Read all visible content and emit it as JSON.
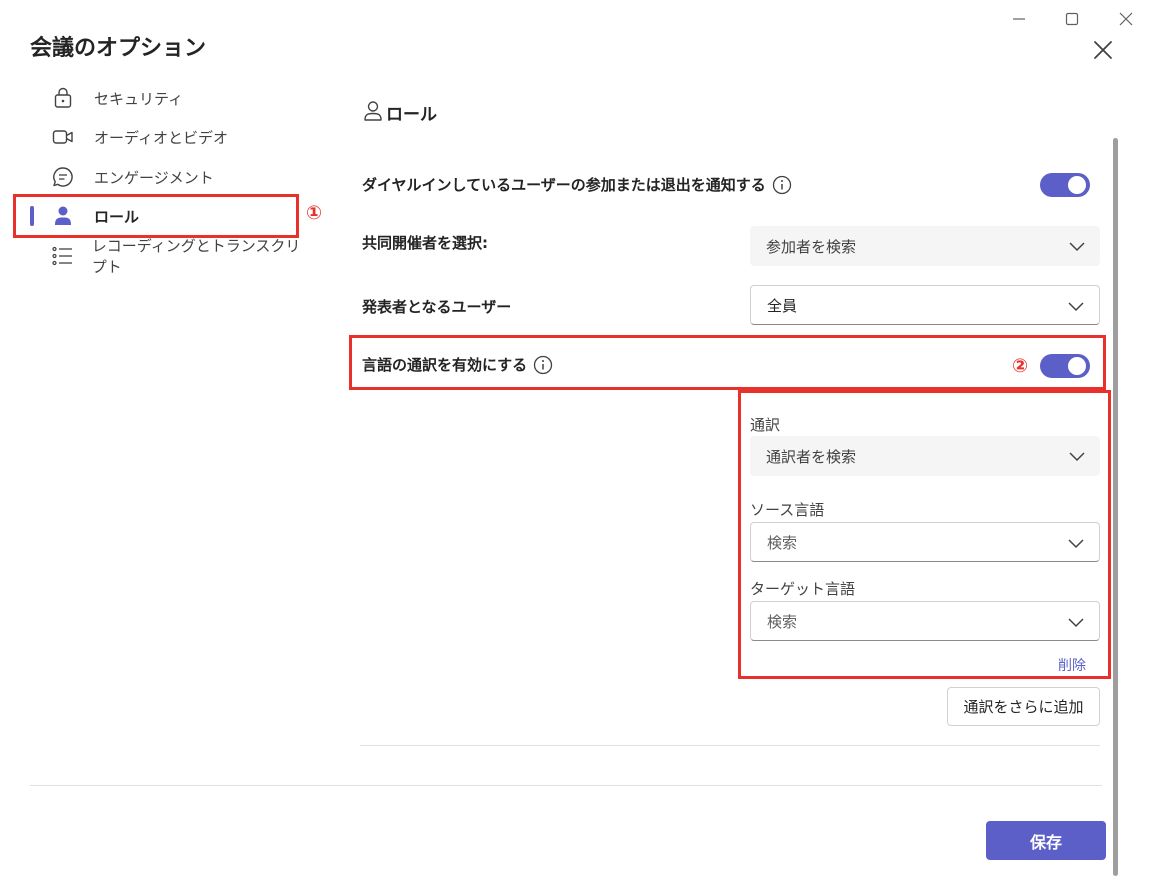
{
  "dialog": {
    "title": "会議のオプション"
  },
  "window_controls": {
    "minimize_icon": "minimize-icon",
    "maximize_icon": "maximize-icon",
    "close_icon": "close-icon"
  },
  "sidebar": {
    "items": [
      {
        "label": "セキュリティ",
        "icon": "lock-icon"
      },
      {
        "label": "オーディオとビデオ",
        "icon": "video-icon"
      },
      {
        "label": "エンゲージメント",
        "icon": "chat-icon"
      },
      {
        "label": "ロール",
        "icon": "person-icon",
        "active": true
      },
      {
        "label": "レコーディングとトランスクリプト",
        "icon": "list-icon"
      }
    ]
  },
  "annotations": {
    "marker1": "①",
    "marker2": "②"
  },
  "main": {
    "section_title": "ロール",
    "dialin_notify": {
      "label": "ダイヤルインしているユーザーの参加または退出を通知する",
      "enabled": true
    },
    "co_organizers": {
      "label": "共同開催者を選択:",
      "placeholder": "参加者を検索"
    },
    "presenters": {
      "label": "発表者となるユーザー",
      "value": "全員"
    },
    "interpretation": {
      "label": "言語の通訳を有効にする",
      "enabled": true,
      "interpreter_label": "通訳",
      "interpreter_placeholder": "通訳者を検索",
      "source_label": "ソース言語",
      "source_placeholder": "検索",
      "target_label": "ターゲット言語",
      "target_placeholder": "検索",
      "delete_label": "削除",
      "add_more_label": "通訳をさらに追加"
    }
  },
  "footer": {
    "save_label": "保存"
  },
  "colors": {
    "accent": "#5b5fc7",
    "highlight_red": "#e8312b"
  }
}
